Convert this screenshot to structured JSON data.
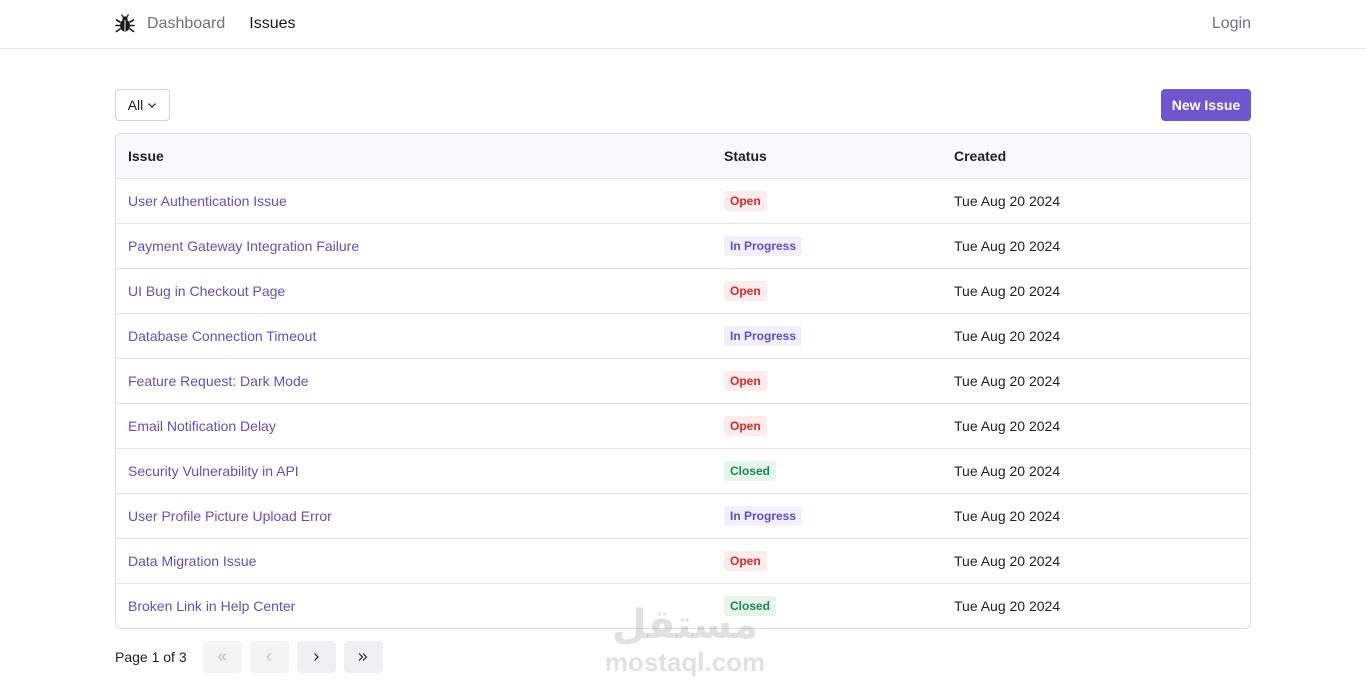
{
  "nav": {
    "logo_icon": "bug-icon",
    "links": [
      {
        "label": "Dashboard",
        "active": false
      },
      {
        "label": "Issues",
        "active": true
      }
    ],
    "login_label": "Login"
  },
  "toolbar": {
    "filter_value": "All",
    "new_issue_label": "New Issue",
    "accent": "#6e56cf"
  },
  "table": {
    "columns": [
      "Issue",
      "Status",
      "Created"
    ],
    "rows": [
      {
        "title": "User Authentication Issue",
        "status": "Open",
        "created": "Tue Aug 20 2024"
      },
      {
        "title": "Payment Gateway Integration Failure",
        "status": "In Progress",
        "created": "Tue Aug 20 2024"
      },
      {
        "title": "UI Bug in Checkout Page",
        "status": "Open",
        "created": "Tue Aug 20 2024"
      },
      {
        "title": "Database Connection Timeout",
        "status": "In Progress",
        "created": "Tue Aug 20 2024"
      },
      {
        "title": "Feature Request: Dark Mode",
        "status": "Open",
        "created": "Tue Aug 20 2024"
      },
      {
        "title": "Email Notification Delay",
        "status": "Open",
        "created": "Tue Aug 20 2024"
      },
      {
        "title": "Security Vulnerability in API",
        "status": "Closed",
        "created": "Tue Aug 20 2024"
      },
      {
        "title": "User Profile Picture Upload Error",
        "status": "In Progress",
        "created": "Tue Aug 20 2024"
      },
      {
        "title": "Data Migration Issue",
        "status": "Open",
        "created": "Tue Aug 20 2024"
      },
      {
        "title": "Broken Link in Help Center",
        "status": "Closed",
        "created": "Tue Aug 20 2024"
      }
    ]
  },
  "status_colors": {
    "Open": "#ce2c31",
    "In Progress": "#5f4ec4",
    "Closed": "#218358"
  },
  "pagination": {
    "label": "Page 1 of 3",
    "buttons": [
      "first-page-icon",
      "prev-page-icon",
      "next-page-icon",
      "last-page-icon"
    ]
  },
  "watermark": {
    "arabic": "مستقل",
    "latin": "mostaql.com"
  }
}
